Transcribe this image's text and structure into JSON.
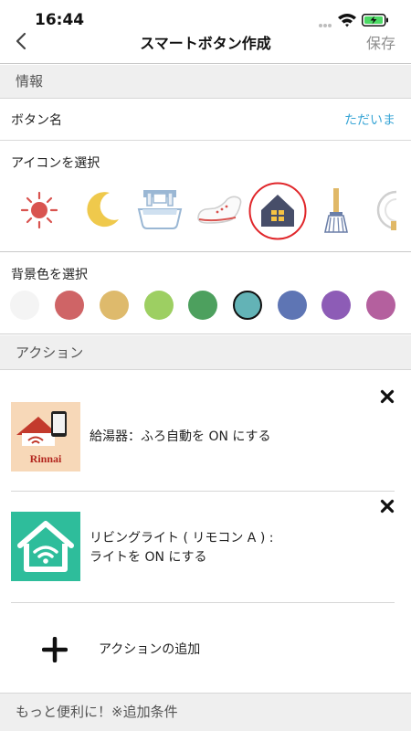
{
  "status": {
    "time": "16:44"
  },
  "nav": {
    "title": "スマートボタン作成",
    "save": "保存"
  },
  "info_header": "情報",
  "button_name": {
    "label": "ボタン名",
    "value": "ただいま"
  },
  "icon_select": {
    "label": "アイコンを選択",
    "icons": [
      "sun-icon",
      "moon-icon",
      "bathtub-icon",
      "shoe-icon",
      "house-icon",
      "broom-icon",
      "plate-icon"
    ],
    "selected": "house-icon",
    "selected_ring_color": "#e0262a"
  },
  "color_select": {
    "label": "背景色を選択",
    "colors": [
      "#f4f4f4",
      "#cf6466",
      "#deba6c",
      "#9dcf62",
      "#4da05e",
      "#63b3b6",
      "#5e75b4",
      "#8d5cb6",
      "#b4609e"
    ],
    "selected": "#63b3b6"
  },
  "actions_header": "アクション",
  "actions": [
    {
      "icon": "rinnai-water-heater-icon",
      "line1": "給湯器：ふろ自動を ON にする",
      "line2": "",
      "brand": "Rinnai"
    },
    {
      "icon": "wifi-house-icon",
      "line1": "リビングライト ( リモコン A ) :",
      "line2": "ライトを ON にする"
    }
  ],
  "add_action": "アクションの追加",
  "more_header": "もっと便利に！※追加条件"
}
